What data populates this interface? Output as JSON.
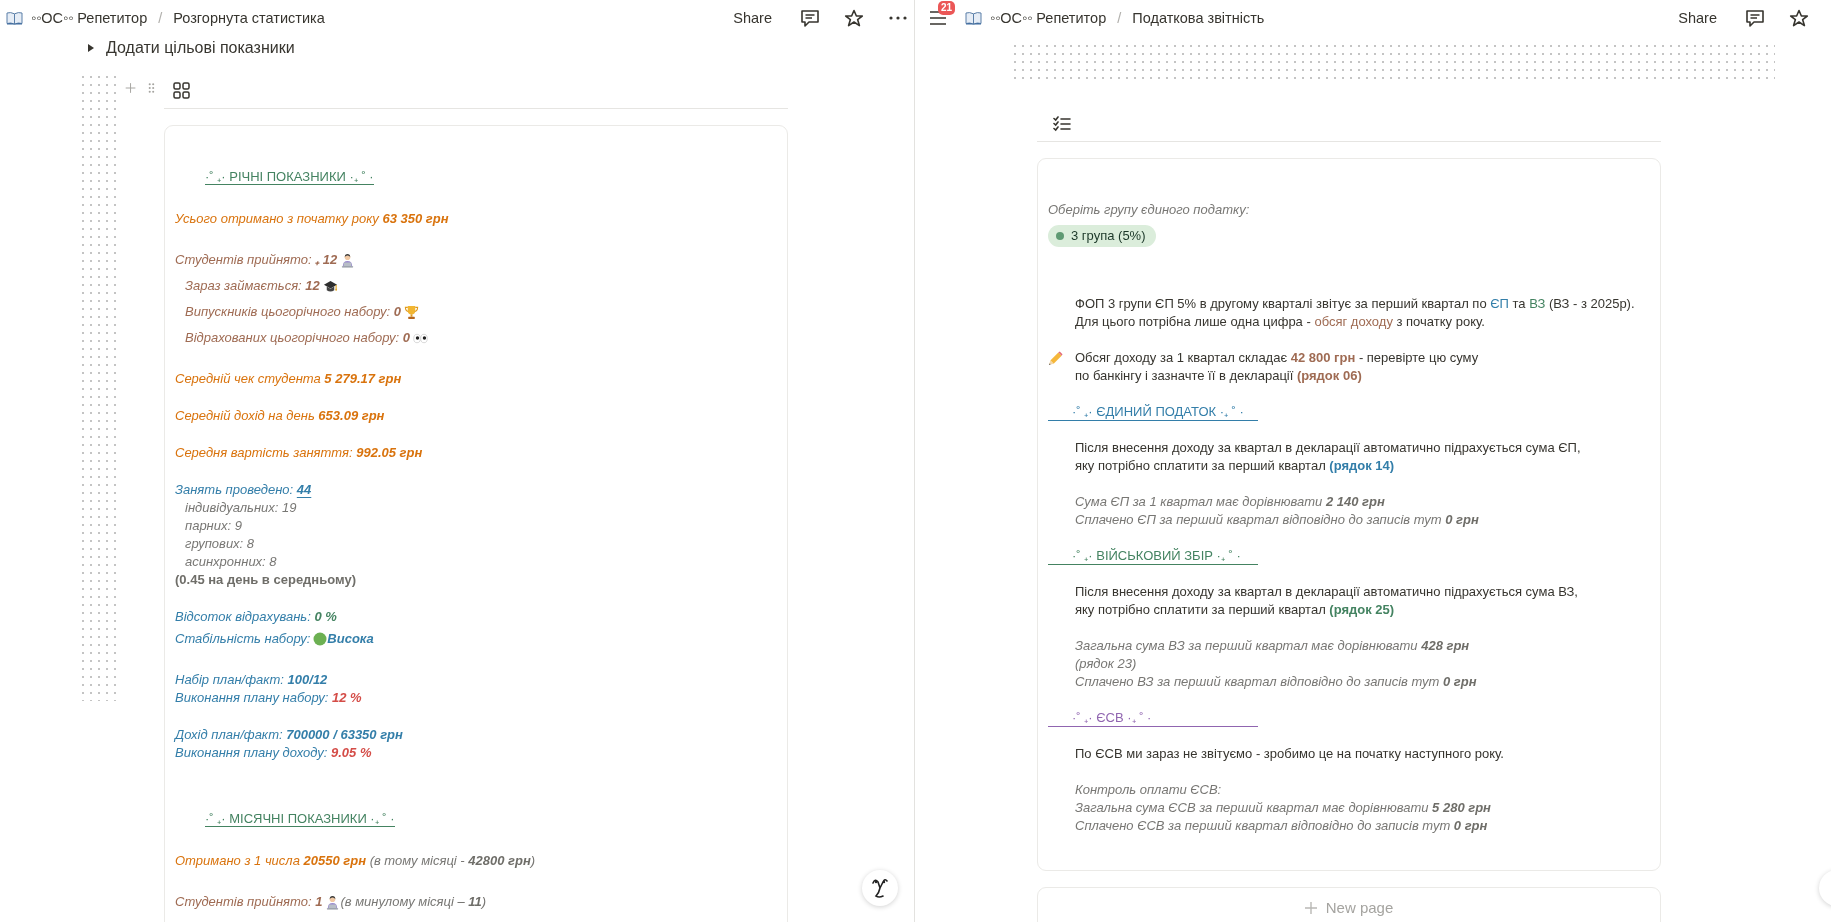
{
  "panes": [
    {
      "kind": "stats",
      "breadcrumb": [
        "◦◦ОС◦◦ Репетитор",
        "Розгорнута статистика"
      ],
      "separator": "/",
      "share": "Share",
      "toggle": {
        "label": "Додати цільові показники",
        "expanded": false
      },
      "blocks": [
        {
          "kind": "heading",
          "text": "·˚ ₊· РІЧНІ ПОКАЗНИКИ ·₊ ˚ ·",
          "color": "#448361"
        },
        {
          "kind": "lines",
          "lines": [
            {
              "indent": false,
              "italic": true,
              "segments": [
                {
                  "kind": "text",
                  "text": "Усього отримано з початку року ",
                  "color": "#d9730d"
                },
                {
                  "kind": "strong",
                  "text": "63 350 грн",
                  "color": "#d9730d"
                }
              ]
            }
          ]
        },
        {
          "kind": "lines",
          "lines": [
            {
              "indent": false,
              "italic": true,
              "segments": [
                {
                  "kind": "text",
                  "text": "Студентів прийнято: ",
                  "color": "#9f6b53"
                },
                {
                  "kind": "strong",
                  "text": "₊ 12 ",
                  "color": "#9f6b53"
                },
                {
                  "kind": "student"
                }
              ]
            },
            {
              "indent": true,
              "italic": true,
              "segments": [
                {
                  "kind": "text",
                  "text": "Зараз займається: ",
                  "color": "#9f6b53"
                },
                {
                  "kind": "strong",
                  "text": "12 ",
                  "color": "#9f6b53"
                },
                {
                  "kind": "graduate"
                }
              ]
            },
            {
              "indent": true,
              "italic": true,
              "segments": [
                {
                  "kind": "text",
                  "text": "Випускників цьогорічного набору: ",
                  "color": "#9f6b53"
                },
                {
                  "kind": "strong",
                  "text": "0 ",
                  "color": "#9f6b53"
                },
                {
                  "kind": "trophy"
                }
              ]
            },
            {
              "indent": true,
              "italic": true,
              "segments": [
                {
                  "kind": "text",
                  "text": "Відрахованих цьогорічного набору: ",
                  "color": "#9f6b53"
                },
                {
                  "kind": "strong",
                  "text": "0 ",
                  "color": "#9f6b53"
                },
                {
                  "kind": "eyes"
                }
              ]
            }
          ]
        },
        {
          "kind": "lines",
          "lines": [
            {
              "indent": false,
              "italic": true,
              "segments": [
                {
                  "kind": "text",
                  "text": "Середній чек студента ",
                  "color": "#d9730d"
                },
                {
                  "kind": "strong",
                  "text": "5 279.17 грн",
                  "color": "#d9730d"
                }
              ]
            }
          ]
        },
        {
          "kind": "lines",
          "lines": [
            {
              "indent": false,
              "italic": true,
              "segments": [
                {
                  "kind": "text",
                  "text": "Середній дохід на день ",
                  "color": "#d9730d"
                },
                {
                  "kind": "strong",
                  "text": "653.09 грн",
                  "color": "#d9730d"
                }
              ]
            }
          ]
        },
        {
          "kind": "lines",
          "lines": [
            {
              "indent": false,
              "italic": true,
              "segments": [
                {
                  "kind": "text",
                  "text": "Середня вартість заняття: ",
                  "color": "#d9730d"
                },
                {
                  "kind": "strong",
                  "text": "992.05 грн",
                  "color": "#d9730d"
                }
              ]
            }
          ]
        },
        {
          "kind": "lines",
          "lines": [
            {
              "indent": false,
              "italic": true,
              "segments": [
                {
                  "kind": "text",
                  "text": "Занять проведено: ",
                  "color": "#337ea9"
                },
                {
                  "kind": "link",
                  "text": "44",
                  "color": "#337ea9"
                }
              ]
            },
            {
              "indent": true,
              "italic": true,
              "segments": [
                {
                  "kind": "text",
                  "text": "індивідуальних: 19",
                  "color": "#787774"
                }
              ]
            },
            {
              "indent": true,
              "italic": true,
              "segments": [
                {
                  "kind": "text",
                  "text": "парних: 9",
                  "color": "#787774"
                }
              ]
            },
            {
              "indent": true,
              "italic": true,
              "segments": [
                {
                  "kind": "text",
                  "text": "групових: 8",
                  "color": "#787774"
                }
              ]
            },
            {
              "indent": true,
              "italic": true,
              "segments": [
                {
                  "kind": "text",
                  "text": "асинхронних: 8",
                  "color": "#787774"
                }
              ]
            },
            {
              "indent": false,
              "italic": false,
              "segments": [
                {
                  "kind": "strong",
                  "text": " (0.45 на день в середньому)",
                  "color": "#6f6e69"
                }
              ]
            }
          ]
        },
        {
          "kind": "lines",
          "lines": [
            {
              "indent": false,
              "italic": true,
              "segments": [
                {
                  "kind": "text",
                  "text": "Відсоток відрахувань: ",
                  "color": "#337ea9"
                },
                {
                  "kind": "strong",
                  "text": "0 %",
                  "color": "#448361"
                }
              ]
            },
            {
              "indent": false,
              "italic": true,
              "segments": [
                {
                  "kind": "text",
                  "text": "Стабільність набору: ",
                  "color": "#337ea9"
                },
                {
                  "kind": "circle"
                },
                {
                  "kind": "strong",
                  "text": " Висока",
                  "color": "#337ea9"
                }
              ]
            }
          ]
        },
        {
          "kind": "lines",
          "lines": [
            {
              "indent": false,
              "italic": true,
              "segments": [
                {
                  "kind": "text",
                  "text": "Набір план/факт: ",
                  "color": "#337ea9"
                },
                {
                  "kind": "strong",
                  "text": "100/12",
                  "color": "#337ea9"
                }
              ]
            },
            {
              "indent": false,
              "italic": true,
              "segments": [
                {
                  "kind": "text",
                  "text": "Виконання плану набору: ",
                  "color": "#337ea9"
                },
                {
                  "kind": "strong",
                  "text": "12 %",
                  "color": "#d44c47"
                }
              ]
            }
          ]
        },
        {
          "kind": "lines",
          "lines": [
            {
              "indent": false,
              "italic": true,
              "segments": [
                {
                  "kind": "text",
                  "text": "Дохід план/факт: ",
                  "color": "#337ea9"
                },
                {
                  "kind": "strong",
                  "text": "700000 / 63350 грн",
                  "color": "#337ea9"
                }
              ]
            },
            {
              "indent": false,
              "italic": true,
              "segments": [
                {
                  "kind": "text",
                  "text": "Виконання плану доходу: ",
                  "color": "#337ea9"
                },
                {
                  "kind": "strong",
                  "text": "9.05 %",
                  "color": "#d44c47"
                }
              ]
            }
          ]
        },
        {
          "kind": "heading",
          "text": "·˚ ₊· МІСЯЧНІ ПОКАЗНИКИ ·₊ ˚ ·",
          "color": "#448361"
        },
        {
          "kind": "lines",
          "lines": [
            {
              "indent": false,
              "italic": true,
              "segments": [
                {
                  "kind": "text",
                  "text": "Отримано з 1 числа ",
                  "color": "#d9730d"
                },
                {
                  "kind": "strong",
                  "text": "20550 грн",
                  "color": "#d9730d"
                },
                {
                  "kind": "text",
                  "text": " (в тому місяці - ",
                  "color": "#787774"
                },
                {
                  "kind": "strong",
                  "text": "42800 грн",
                  "color": "#6f6e69"
                },
                {
                  "kind": "text",
                  "text": ")",
                  "color": "#787774"
                }
              ]
            }
          ]
        },
        {
          "kind": "lines",
          "lines": [
            {
              "indent": false,
              "italic": true,
              "segments": [
                {
                  "kind": "text",
                  "text": "Студентів прийнято: ",
                  "color": "#9f6b53"
                },
                {
                  "kind": "strong",
                  "text": "1 ",
                  "color": "#9f6b53"
                },
                {
                  "kind": "student"
                },
                {
                  "kind": "text",
                  "text": " (в минулому місяці – ",
                  "color": "#787774"
                },
                {
                  "kind": "strong",
                  "text": "11",
                  "color": "#6f6e69"
                },
                {
                  "kind": "text",
                  "text": ")",
                  "color": "#787774"
                }
              ]
            }
          ]
        }
      ]
    },
    {
      "kind": "report",
      "badge": "21",
      "breadcrumb": [
        "◦◦ОС◦◦ Репетитор",
        "Податкова звітність"
      ],
      "separator": "/",
      "share": "Share",
      "blocks": [
        {
          "kind": "lines",
          "lines": [
            {
              "indent": false,
              "italic": true,
              "segments": [
                {
                  "kind": "text",
                  "text": "Оберіть групу єдиного податку:",
                  "color": "#787774"
                }
              ]
            }
          ]
        },
        {
          "kind": "tag",
          "text": "3 група (5%)"
        },
        {
          "kind": "note",
          "lines": [
            {
              "italic": false,
              "segments": [
                {
                  "kind": "text",
                  "text": "ФОП 3 групи ЄП 5% в другому кварталі звітує за перший квартал по ",
                  "color": "#37352f"
                },
                {
                  "kind": "text",
                  "text": "ЄП",
                  "color": "#337ea9"
                },
                {
                  "kind": "text",
                  "text": " та ",
                  "color": "#37352f"
                },
                {
                  "kind": "text",
                  "text": "ВЗ",
                  "color": "#448361"
                },
                {
                  "kind": "text",
                  "text": " (ВЗ - з 2025р).",
                  "color": "#37352f"
                }
              ]
            },
            {
              "italic": false,
              "segments": [
                {
                  "kind": "text",
                  "text": "Для цього потрібна лише одна цифра - ",
                  "color": "#37352f"
                },
                {
                  "kind": "text",
                  "text": "обсяг доходу",
                  "color": "#9f6b53"
                },
                {
                  "kind": "text",
                  "text": " з початку року.",
                  "color": "#37352f"
                }
              ]
            }
          ]
        },
        {
          "kind": "note",
          "lines": [
            {
              "italic": false,
              "segments": [
                {
                  "kind": "pencil"
                },
                {
                  "kind": "text",
                  "text": "Обсяг доходу за 1 квартал складає ",
                  "color": "#37352f"
                },
                {
                  "kind": "strong",
                  "text": "42 800 грн",
                  "color": "#9f6b53"
                },
                {
                  "kind": "text",
                  "text": " - перевірте цю суму",
                  "color": "#37352f"
                }
              ]
            },
            {
              "italic": false,
              "segments": [
                {
                  "kind": "text",
                  "text": "по банкінгу і зазначте її в декларації ",
                  "color": "#37352f"
                },
                {
                  "kind": "strong",
                  "text": "(рядок 06)",
                  "color": "#9f6b53"
                }
              ]
            }
          ]
        },
        {
          "kind": "section",
          "text": "·˚ ₊· ЄДИНИЙ ПОДАТОК ·₊ ˚ ·",
          "color": "#337ea9"
        },
        {
          "kind": "note",
          "lines": [
            {
              "italic": false,
              "segments": [
                {
                  "kind": "text",
                  "text": "Після внесення доходу за квартал в декларації автоматично підрахується сума ЄП,",
                  "color": "#37352f"
                }
              ]
            },
            {
              "italic": false,
              "segments": [
                {
                  "kind": "text",
                  "text": "яку потрібно сплатити за перший квартал ",
                  "color": "#37352f"
                },
                {
                  "kind": "strong",
                  "text": "(рядок 14)",
                  "color": "#337ea9"
                }
              ]
            }
          ]
        },
        {
          "kind": "note",
          "lines": [
            {
              "italic": true,
              "segments": [
                {
                  "kind": "text",
                  "text": "Сума ЄП за 1 квартал має дорівнювати ",
                  "color": "#787774"
                },
                {
                  "kind": "strong",
                  "text": "2 140 грн",
                  "color": "#6f6e69"
                }
              ]
            },
            {
              "italic": true,
              "segments": [
                {
                  "kind": "text",
                  "text": "Сплачено ЄП за перший квартал відповідно до записів тут ",
                  "color": "#787774"
                },
                {
                  "kind": "strong",
                  "text": "0 грн",
                  "color": "#6f6e69"
                }
              ]
            }
          ]
        },
        {
          "kind": "section",
          "text": "·˚ ₊· ВІЙСЬКОВИЙ ЗБІР ·₊ ˚ ·",
          "color": "#448361"
        },
        {
          "kind": "note",
          "lines": [
            {
              "italic": false,
              "segments": [
                {
                  "kind": "text",
                  "text": "Після внесення доходу за квартал в декларації автоматично підрахується сума ВЗ,",
                  "color": "#37352f"
                }
              ]
            },
            {
              "italic": false,
              "segments": [
                {
                  "kind": "text",
                  "text": "яку потрібно сплатити за перший квартал ",
                  "color": "#37352f"
                },
                {
                  "kind": "strong",
                  "text": "(рядок 25)",
                  "color": "#448361"
                }
              ]
            }
          ]
        },
        {
          "kind": "note",
          "lines": [
            {
              "italic": true,
              "segments": [
                {
                  "kind": "text",
                  "text": "Загальна сума ВЗ за перший квартал має дорівнювати ",
                  "color": "#787774"
                },
                {
                  "kind": "strong",
                  "text": "428 грн",
                  "color": "#6f6e69"
                }
              ]
            },
            {
              "italic": true,
              "segments": [
                {
                  "kind": "text",
                  "text": "(рядок 23)",
                  "color": "#787774"
                }
              ]
            },
            {
              "italic": true,
              "segments": [
                {
                  "kind": "text",
                  "text": "Сплачено ВЗ за перший квартал відповідно до записів тут ",
                  "color": "#787774"
                },
                {
                  "kind": "strong",
                  "text": "0 грн",
                  "color": "#6f6e69"
                }
              ]
            }
          ]
        },
        {
          "kind": "section",
          "text": "·˚ ₊· ЄСВ ·₊ ˚ ·",
          "color": "#9065b0"
        },
        {
          "kind": "note",
          "lines": [
            {
              "italic": false,
              "segments": [
                {
                  "kind": "text",
                  "text": "По ЄСВ ми зараз не звітуємо - зробимо це на початку наступного року.",
                  "color": "#37352f"
                }
              ]
            }
          ]
        },
        {
          "kind": "note",
          "lines": [
            {
              "italic": true,
              "segments": [
                {
                  "kind": "text",
                  "text": "Контроль оплати ЄСВ:",
                  "color": "#787774"
                }
              ]
            },
            {
              "italic": true,
              "segments": [
                {
                  "kind": "text",
                  "text": "Загальна сума ЄСВ за перший квартал має дорівнювати ",
                  "color": "#787774"
                },
                {
                  "kind": "strong",
                  "text": "5 280 грн",
                  "color": "#6f6e69"
                }
              ]
            },
            {
              "italic": true,
              "segments": [
                {
                  "kind": "text",
                  "text": "Сплачено ЄСВ за перший квартал відповідно до записів тут ",
                  "color": "#787774"
                },
                {
                  "kind": "strong",
                  "text": "0 грн",
                  "color": "#6f6e69"
                }
              ]
            }
          ]
        }
      ],
      "new_page": "New page"
    }
  ]
}
